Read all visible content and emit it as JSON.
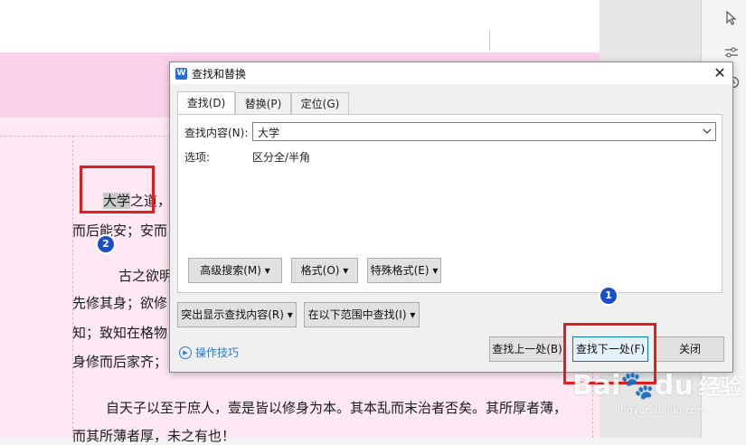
{
  "dialog": {
    "title": "查找和替换",
    "app_icon": "W",
    "close_glyph": "✕",
    "tabs": [
      {
        "label": "查找(D)",
        "active": true
      },
      {
        "label": "替换(P)",
        "active": false
      },
      {
        "label": "定位(G)",
        "active": false
      }
    ],
    "find_label": "查找内容(N):",
    "find_value": "大学",
    "options_label": "选项:",
    "options_value": "区分全/半角",
    "buttons": {
      "advanced": "高级搜索(M) ▾",
      "format": "格式(O) ▾",
      "special": "特殊格式(E) ▾",
      "highlight": "突出显示查找内容(R) ▾",
      "range": "在以下范围中查找(I) ▾",
      "find_prev": "查找上一处(B)",
      "find_next": "查找下一处(F)",
      "close": "关闭"
    },
    "help_link": "操作技巧"
  },
  "document": {
    "lines": [
      {
        "pre": "",
        "highlight": "大学",
        "post": "之道，"
      },
      {
        "text": "而后能安；安而"
      },
      {
        "text": "古之欲明"
      },
      {
        "text": "先修其身；欲修"
      },
      {
        "text": "知；致知在格物"
      },
      {
        "text": "身修而后家齐；"
      },
      {
        "text": "自天子以至于庶人，壹是皆以修身为本。其本乱而末治者否矣。其所厚者薄，"
      },
      {
        "text": "而其所薄者厚，未之有也！"
      }
    ]
  },
  "annotations": {
    "badge1": "1",
    "badge2": "2",
    "accent_red": "#e21d1d",
    "badge_blue": "#1c4fc7"
  },
  "watermark": {
    "brand": "Bai",
    "brand2": "du",
    "suffix": "经验",
    "url": "jingyan.baidu.com"
  },
  "right_toolbar": {
    "icons": [
      "cursor-icon",
      "sliders-icon",
      "history-icon"
    ]
  }
}
